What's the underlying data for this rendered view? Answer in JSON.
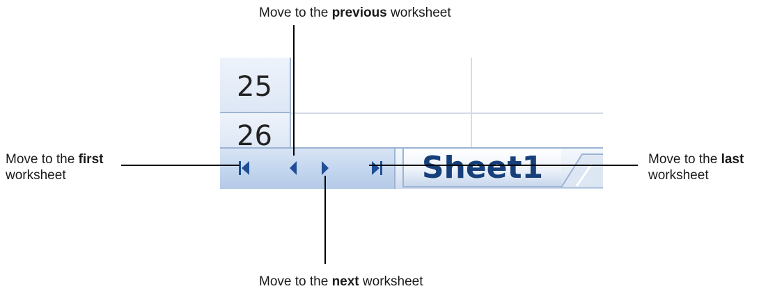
{
  "spreadsheet": {
    "row_headers": [
      "25",
      "26"
    ],
    "sheet_tab_label": "Sheet1",
    "nav_buttons": [
      {
        "name": "first-sheet-button",
        "icon": "first-sheet-icon"
      },
      {
        "name": "previous-sheet-button",
        "icon": "previous-sheet-icon"
      },
      {
        "name": "next-sheet-button",
        "icon": "next-sheet-icon"
      },
      {
        "name": "last-sheet-button",
        "icon": "last-sheet-icon"
      }
    ],
    "colors": {
      "arrow": "#1f4e96",
      "tab_text": "#17407a",
      "header_bg": "#e4ecf7"
    }
  },
  "callouts": {
    "previous": {
      "pre": "Move to the ",
      "bold": "previous",
      "post": " worksheet"
    },
    "first": {
      "pre": "Move to the ",
      "bold": "first",
      "line2": "worksheet"
    },
    "last": {
      "pre": "Move to the ",
      "bold": "last",
      "line2": "worksheet"
    },
    "next": {
      "pre": "Move to the ",
      "bold": "next",
      "post": " worksheet"
    }
  }
}
